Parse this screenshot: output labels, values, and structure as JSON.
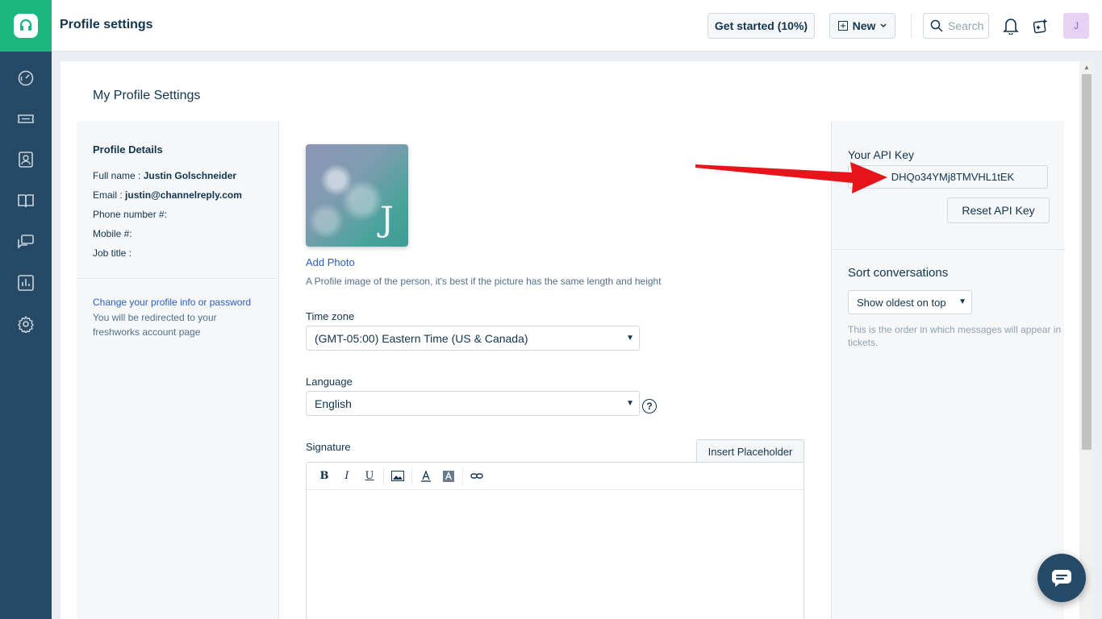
{
  "header": {
    "title": "Profile settings",
    "get_started_label": "Get started (10%)",
    "new_label": "New",
    "search_placeholder": "Search",
    "avatar_initial": "J"
  },
  "nav_icons": [
    "headset-logo-icon",
    "dashboard-icon",
    "ticket-icon",
    "contacts-icon",
    "book-icon",
    "chat-icon",
    "reports-icon",
    "settings-icon"
  ],
  "card": {
    "title": "My Profile Settings"
  },
  "profile_details": {
    "title": "Profile Details",
    "full_name_label": "Full name :",
    "full_name_value": "Justin Golschneider",
    "email_label": "Email :",
    "email_value": "justin@channelreply.com",
    "phone_label": "Phone number #:",
    "mobile_label": "Mobile #:",
    "job_title_label": "Job title :",
    "change_link": "Change your profile info or password",
    "redirect_note": "You will be redirected to your freshworks account page"
  },
  "photo": {
    "letter": "J",
    "add_label": "Add Photo",
    "note": "A Profile image of the person, it's best if the picture has the same length and height"
  },
  "timezone": {
    "label": "Time zone",
    "value": "(GMT-05:00) Eastern Time (US & Canada)"
  },
  "language": {
    "label": "Language",
    "value": "English"
  },
  "signature": {
    "label": "Signature",
    "insert_placeholder_label": "Insert Placeholder",
    "toolbar": [
      "B",
      "I",
      "U"
    ]
  },
  "api": {
    "label": "Your API Key",
    "value": "DHQo34YMj8TMVHL1tEK",
    "reset_label": "Reset API Key"
  },
  "sort": {
    "title": "Sort conversations",
    "value": "Show oldest on top",
    "note": "This is the order in which messages will appear in tickets."
  },
  "colors": {
    "brand_green": "#1cb77f",
    "nav_bg": "#264966",
    "link_blue": "#2c5cc5",
    "arrow_red": "#e8141b"
  }
}
